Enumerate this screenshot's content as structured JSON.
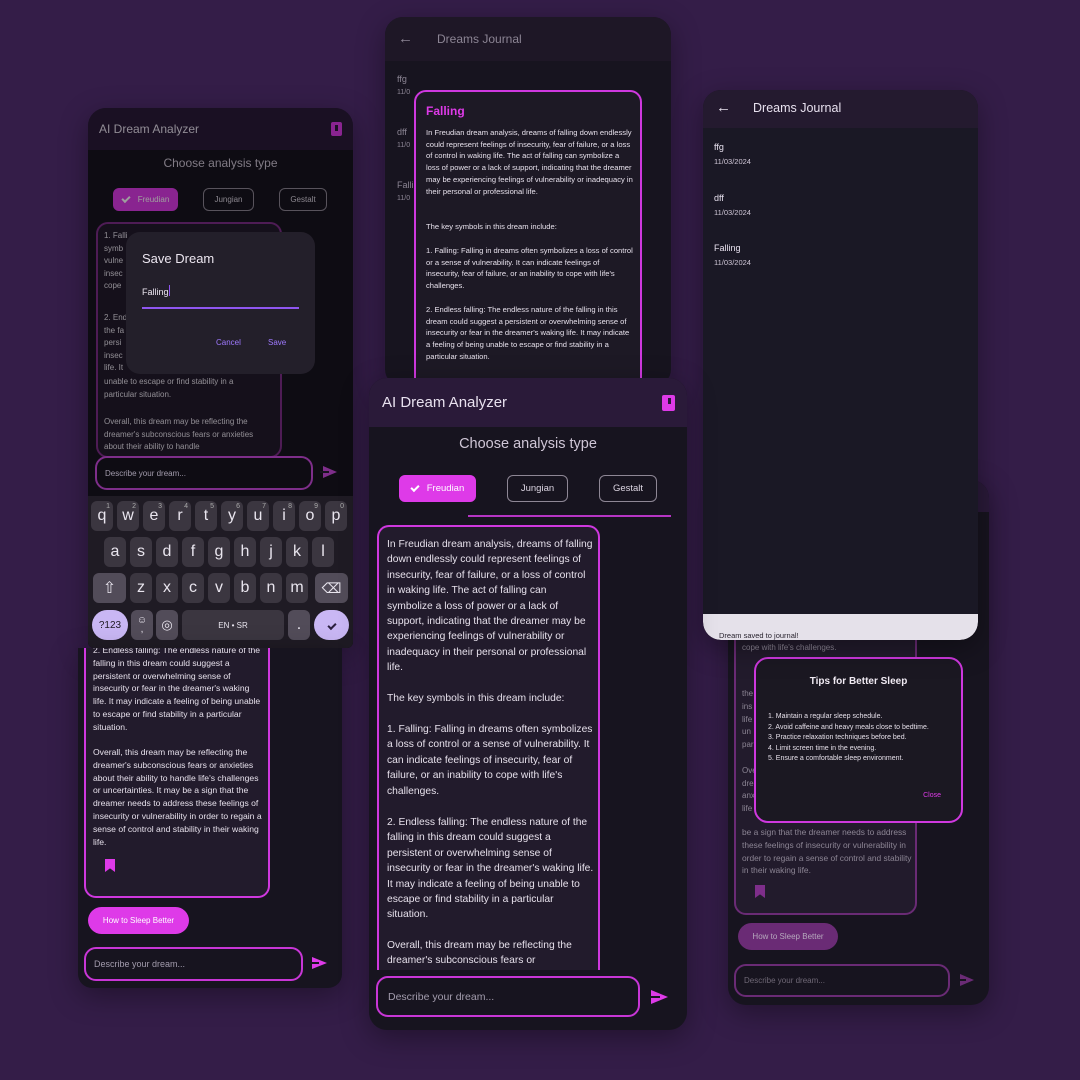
{
  "colors": {
    "background": "#341d48",
    "accent": "#de3ae8",
    "surface": "#17141f",
    "appbar": "#2a1a39"
  },
  "icons": {
    "back": "arrow-left-icon",
    "journal": "book-icon",
    "send": "send-icon",
    "bookmark": "bookmark-icon",
    "check": "check-icon",
    "globe": "globe-icon",
    "emoji": "emoji-icon",
    "shift": "shift-icon",
    "delete": "backspace-icon"
  },
  "app": {
    "title": "AI Dream Analyzer",
    "analysis_prompt": "Choose analysis type",
    "chips": {
      "freudian": "Freudian",
      "jungian": "Jungian",
      "gestalt": "Gestalt"
    },
    "input_placeholder": "Describe your dream...",
    "sleep_button": "How to Sleep Better"
  },
  "journal": {
    "title": "Dreams Journal",
    "entries": [
      {
        "name": "ffg",
        "date": "11/03/2024"
      },
      {
        "name": "dff",
        "date": "11/03/2024"
      },
      {
        "name": "Falling",
        "date": "11/03/2024"
      }
    ],
    "entries_cropped": [
      {
        "name": "ffg",
        "date": "11/0"
      },
      {
        "name": "dff",
        "date": "11/0"
      },
      {
        "name": "Falli",
        "date": "11/0"
      }
    ],
    "snackbar": "Dream saved to journal!"
  },
  "analysis": {
    "title": "Falling",
    "p1": "In Freudian dream analysis, dreams of falling down endlessly could represent feelings of insecurity, fear of failure, or a loss of control in waking life. The act of falling can symbolize a loss of power or a lack of support, indicating that the dreamer may be experiencing feelings of vulnerability or inadequacy in their personal or professional life.",
    "p2": "The key symbols in this dream include:",
    "p3": "1. Falling: Falling in dreams often symbolizes a loss of control or a sense of vulnerability. It can indicate feelings of insecurity, fear of failure, or an inability to cope with life's challenges.",
    "p4": "2. Endless falling: The endless nature of the falling in this dream could suggest a persistent or overwhelming sense of insecurity or fear in the dreamer's waking life. It may indicate a feeling of being unable to escape or find stability in a particular situation.",
    "p5": "Overall, this dream may be reflecting the dreamer's subconscious fears or anxieties about their ability to handle life's challenges or uncertainties. It may be a sign that the dreamer needs to address these feelings of insecurity or vulnerability in order to regain a sense of control and stability in their waking life.",
    "p5_short": "Overall, this dream may be reflecting the dreamer's subconscious fears or anxieties about their ability to handle",
    "p5_tail": "be a sign that the dreamer needs to address these feelings of insecurity or vulnerability in order to regain a sense of control and stability in their waking life.",
    "p5_cut": "Overall, this dream may be reflecting the dreamer's subconscious fears or",
    "p3_tail": "cope with life's challenges.",
    "frag1": "1. Falli\nsymb\nvulne\ninsec\ncope",
    "frag2": "2. End\nthe fa\npersi\ninsec\nlife. It",
    "frag3": "unable to escape or find stability in a\nparticular situation.",
    "frag_tips": "the\nins\nlife\nun\npar\n\nOve\ndre\nanx\nlife\n"
  },
  "save_dialog": {
    "title": "Save Dream",
    "value": "Falling",
    "cancel": "Cancel",
    "save": "Save"
  },
  "tips_dialog": {
    "title": "Tips for Better Sleep",
    "items": [
      "1. Maintain a regular sleep schedule.",
      "2. Avoid caffeine and heavy meals close to bedtime.",
      "3. Practice relaxation techniques before bed.",
      "4. Limit screen time in the evening.",
      "5. Ensure a comfortable sleep environment."
    ],
    "close": "Close"
  },
  "keyboard": {
    "row1": [
      "q",
      "w",
      "e",
      "r",
      "t",
      "y",
      "u",
      "i",
      "o",
      "p"
    ],
    "row1_hints": [
      "1",
      "2",
      "3",
      "4",
      "5",
      "6",
      "7",
      "8",
      "9",
      "0"
    ],
    "row2": [
      "a",
      "s",
      "d",
      "f",
      "g",
      "h",
      "j",
      "k",
      "l"
    ],
    "row3": [
      "z",
      "x",
      "c",
      "v",
      "b",
      "n",
      "m"
    ],
    "symbols": "?123",
    "comma": ",",
    "space": "EN • SR",
    "period": "."
  }
}
